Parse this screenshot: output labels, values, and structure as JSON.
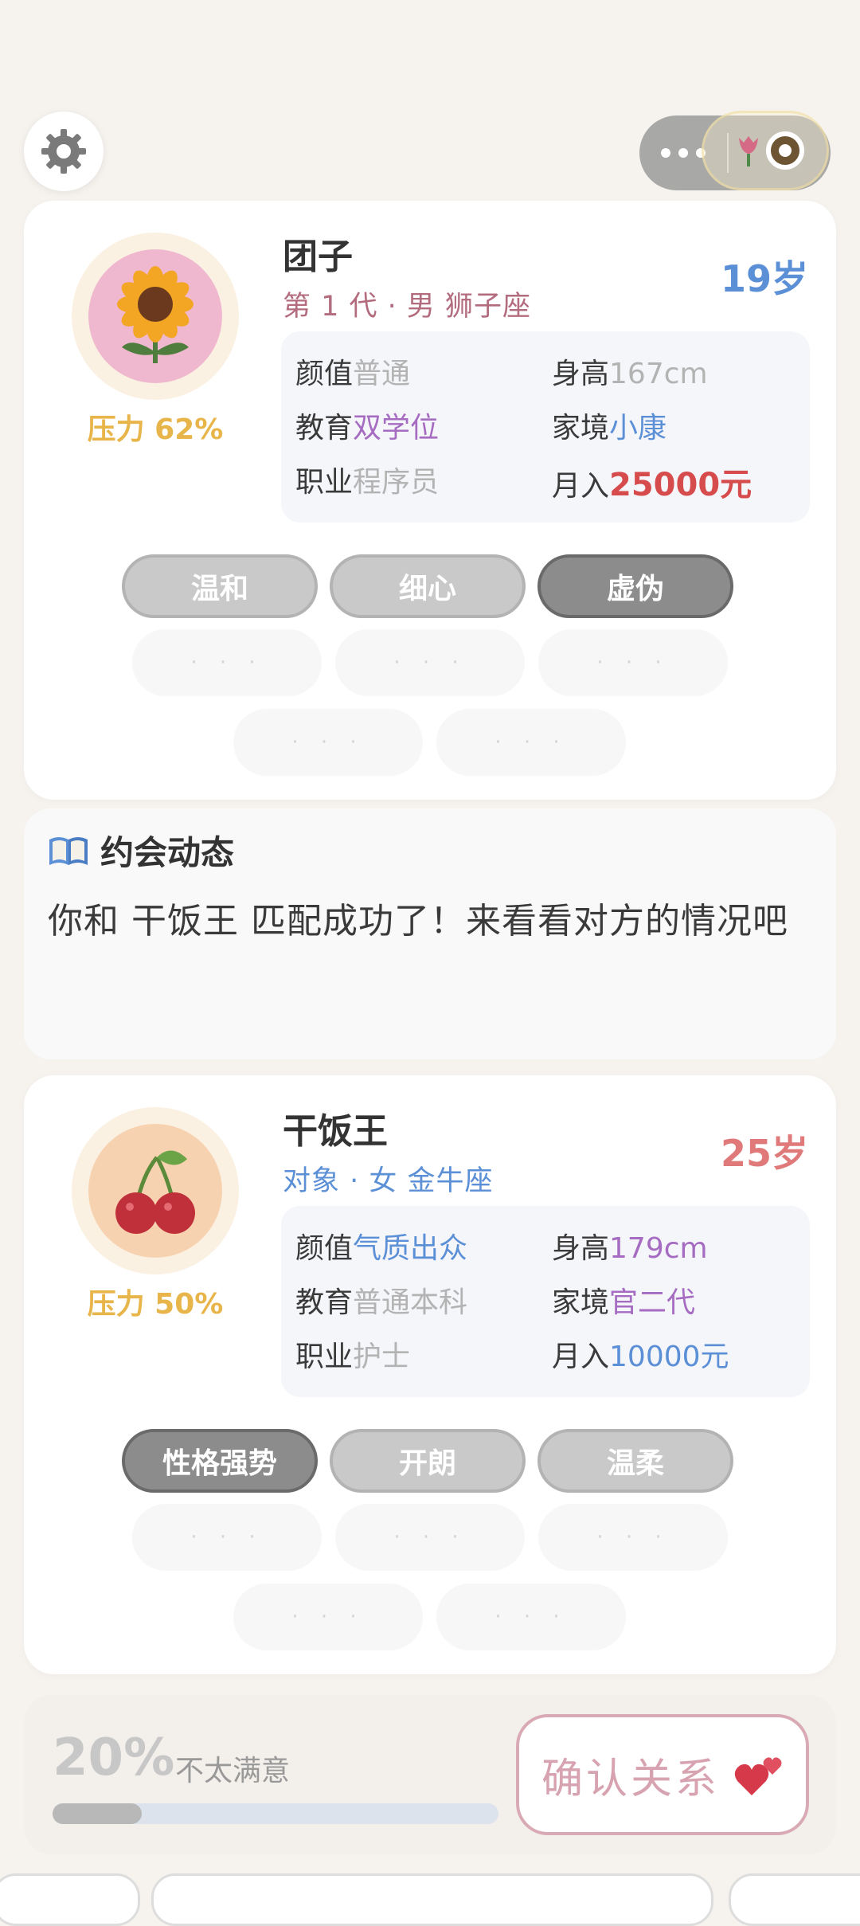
{
  "player": {
    "name": "团子",
    "subtitle": "第 1 代 · 男 狮子座",
    "age": "19岁",
    "pressure": "压力 62%",
    "stats": [
      {
        "key": "颜值",
        "value": "普通",
        "color": "#b3b3b3"
      },
      {
        "key": "身高",
        "value": "167cm",
        "color": "#b3b3b3"
      },
      {
        "key": "教育",
        "value": "双学位",
        "color": "#a56cc1"
      },
      {
        "key": "家境",
        "value": "小康",
        "color": "#5b8fd6"
      },
      {
        "key": "职业",
        "value": "程序员",
        "color": "#b3b3b3"
      },
      {
        "key": "月入",
        "value": "25000元",
        "color": "#d64b4b"
      }
    ],
    "tags": [
      "温和",
      "细心",
      "虚伪"
    ],
    "placeholder": "· · ·",
    "colors": {
      "subtitle": "#b36b7e",
      "age": "#5b8fd6",
      "avatar_bg": "#efb8cf"
    }
  },
  "news": {
    "icon": "book-icon",
    "title": "约会动态",
    "text": "你和 干饭王 匹配成功了！来看看对方的情况吧"
  },
  "partner": {
    "name": "干饭王",
    "subtitle": "对象 · 女 金牛座",
    "age": "25岁",
    "pressure": "压力 50%",
    "stats": [
      {
        "key": "颜值",
        "value": "气质出众",
        "color": "#5b8fd6"
      },
      {
        "key": "身高",
        "value": "179cm",
        "color": "#a56cc1"
      },
      {
        "key": "教育",
        "value": "普通本科",
        "color": "#b3b3b3"
      },
      {
        "key": "家境",
        "value": "官二代",
        "color": "#a56cc1"
      },
      {
        "key": "职业",
        "value": "护士",
        "color": "#b3b3b3"
      },
      {
        "key": "月入",
        "value": "10000元",
        "color": "#5b8fd6"
      }
    ],
    "tags": [
      "性格强势",
      "开朗",
      "温柔"
    ],
    "placeholder": "· · ·",
    "colors": {
      "subtitle": "#5b8fd6",
      "age": "#e07a7a",
      "avatar_bg": "#f7d2b0"
    }
  },
  "bottom": {
    "satisfaction_pct": "20%",
    "satisfaction_value": 0.2,
    "mood": "不太满意",
    "confirm_label": "确认关系"
  }
}
